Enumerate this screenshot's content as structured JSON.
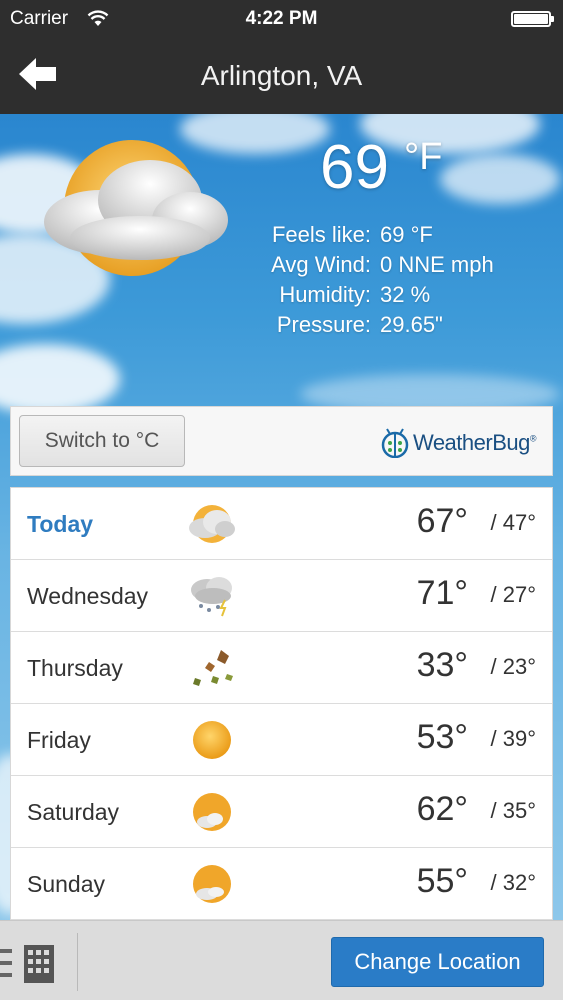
{
  "status_bar": {
    "carrier": "Carrier",
    "time": "4:22 PM"
  },
  "nav": {
    "title": "Arlington, VA"
  },
  "current": {
    "temp": "69",
    "unit": "°F",
    "details": [
      {
        "label": "Feels like:",
        "value": "69 °F"
      },
      {
        "label": "Avg Wind:",
        "value": "0 NNE mph"
      },
      {
        "label": "Humidity:",
        "value": "32 %"
      },
      {
        "label": "Pressure:",
        "value": "29.65\""
      }
    ]
  },
  "unit_switch": {
    "label": "Switch to °C"
  },
  "brand": {
    "name": "WeatherBug",
    "mark": "®"
  },
  "forecast": [
    {
      "day": "Today",
      "hi": "67°",
      "lo": "/ 47°",
      "icon": "partly-cloudy-icon"
    },
    {
      "day": "Wednesday",
      "hi": "71°",
      "lo": "/ 27°",
      "icon": "storm-icon"
    },
    {
      "day": "Thursday",
      "hi": "33°",
      "lo": "/ 23°",
      "icon": "windy-leaves-icon"
    },
    {
      "day": "Friday",
      "hi": "53°",
      "lo": "/ 39°",
      "icon": "sunny-icon"
    },
    {
      "day": "Saturday",
      "hi": "62°",
      "lo": "/ 35°",
      "icon": "mostly-sunny-icon"
    },
    {
      "day": "Sunday",
      "hi": "55°",
      "lo": "/ 32°",
      "icon": "mostly-sunny-icon"
    }
  ],
  "toolbar": {
    "change_location": "Change Location"
  },
  "colors": {
    "accent": "#2a7cc7",
    "today": "#2f7cc0",
    "bar": "#2e2e2e"
  }
}
